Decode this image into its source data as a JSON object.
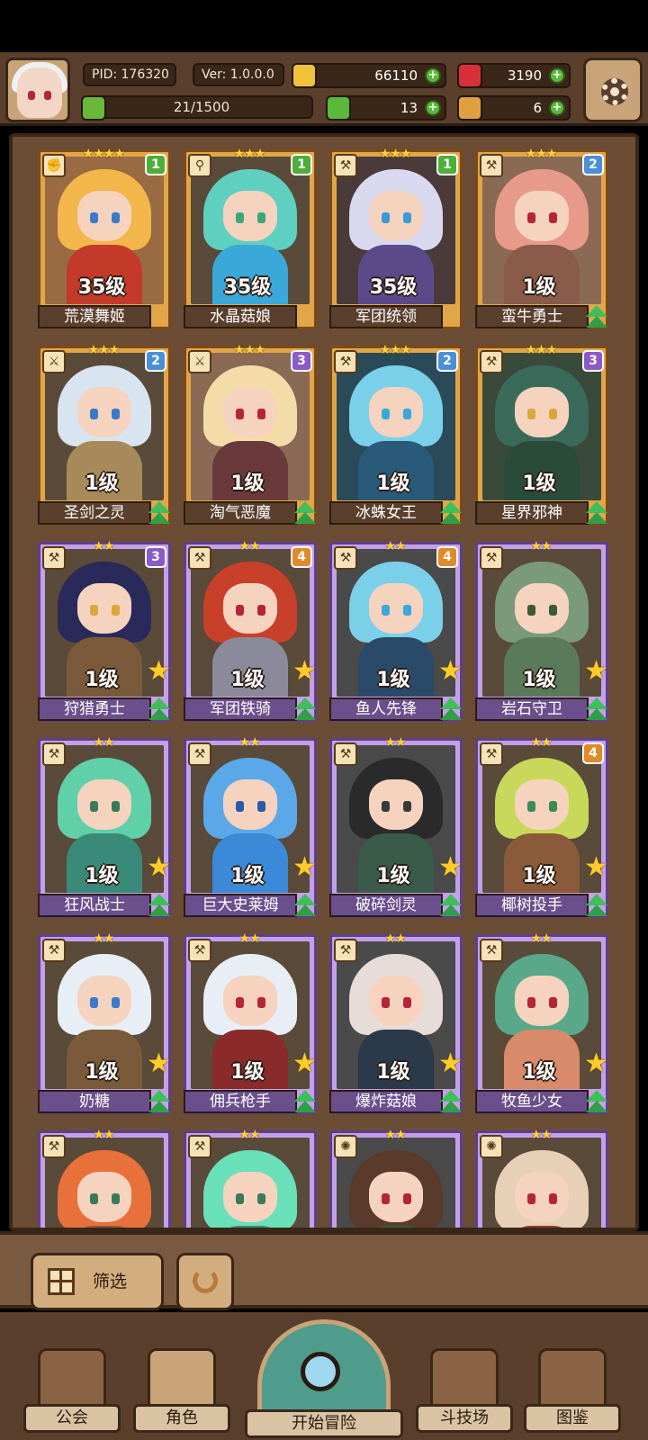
{
  "player": {
    "pid": "PID: 176320",
    "version": "Ver: 1.0.0.0",
    "exp_text": "21/1500",
    "exp_progress": 0.014
  },
  "resources": {
    "gold": "66110",
    "ruby": "3190",
    "clover": "13",
    "hammer": "6"
  },
  "colors": {
    "panel_brown": "#6b4d36",
    "card_gold": "#e0a648",
    "card_purple": "#c4a0e8",
    "upgrade_green": "#3fbf5a",
    "rank_green": "#4fae3a",
    "rank_blue": "#4a8fd8",
    "rank_purple": "#8a5ac8",
    "rank_orange": "#e08a2a"
  },
  "characters": [
    {
      "name": "荒漠舞姬",
      "level": "35级",
      "stars": "★★★★",
      "rank": "1",
      "rarity": "gold",
      "weapon_icon": "fist-icon",
      "hair": "#f2b64a",
      "body": "#c43a2a",
      "bg": "#9a6a42",
      "eye": "#3a7ac8",
      "upgrade": false
    },
    {
      "name": "水晶菇娘",
      "level": "35级",
      "stars": "★★★",
      "rank": "1",
      "rarity": "gold",
      "weapon_icon": "staff-icon",
      "hair": "#5fd0c0",
      "body": "#3aa8d8",
      "bg": "#5a4a3a",
      "eye": "#3aa87a",
      "upgrade": false
    },
    {
      "name": "军团统领",
      "level": "35级",
      "stars": "★★★",
      "rank": "1",
      "rarity": "gold",
      "weapon_icon": "axe-icon",
      "hair": "#d8d8ee",
      "body": "#5a4a8a",
      "bg": "#4a3a3a",
      "eye": "#3a9ad8",
      "upgrade": false
    },
    {
      "name": "蛮牛勇士",
      "level": "1级",
      "stars": "★★★",
      "rank": "2",
      "rarity": "gold",
      "weapon_icon": "axe-icon",
      "hair": "#e89a8a",
      "body": "#8a5a4a",
      "bg": "#8a6a54",
      "eye": "#b6243c",
      "upgrade": true
    },
    {
      "name": "圣剑之灵",
      "level": "1级",
      "stars": "★★★",
      "rank": "2",
      "rarity": "gold",
      "weapon_icon": "sword-icon",
      "hair": "#d8e4f0",
      "body": "#a88a5a",
      "bg": "#5a4a3a",
      "eye": "#3a7ac8",
      "upgrade": true
    },
    {
      "name": "淘气恶魔",
      "level": "1级",
      "stars": "★★★",
      "rank": "3",
      "rarity": "gold",
      "weapon_icon": "sword-icon",
      "hair": "#f4dca8",
      "body": "#6a3a3a",
      "bg": "#8a6a54",
      "eye": "#b6243c",
      "upgrade": true
    },
    {
      "name": "冰蛛女王",
      "level": "1级",
      "stars": "★★★",
      "rank": "2",
      "rarity": "gold",
      "weapon_icon": "axe-icon",
      "hair": "#7ad0e8",
      "body": "#2a5a7a",
      "bg": "#2a4a5a",
      "eye": "#3aa8d8",
      "upgrade": true
    },
    {
      "name": "星界邪神",
      "level": "1级",
      "stars": "★★★",
      "rank": "3",
      "rarity": "gold",
      "weapon_icon": "axe-icon",
      "hair": "#3a6a5a",
      "body": "#2a4a3a",
      "bg": "#3a4a3a",
      "eye": "#d8a83a",
      "upgrade": true
    },
    {
      "name": "狩猎勇士",
      "level": "1级",
      "stars": "★★",
      "rank": "3",
      "rarity": "purple",
      "weapon_icon": "axe-icon",
      "hair": "#2a2a5a",
      "body": "#7a5a3a",
      "bg": "#5a4a3a",
      "eye": "#d8a83a",
      "upgrade": true
    },
    {
      "name": "军团铁骑",
      "level": "1级",
      "stars": "★★",
      "rank": "4",
      "rarity": "purple",
      "weapon_icon": "axe-icon",
      "hair": "#c8402a",
      "body": "#8a8a9a",
      "bg": "#5a4a3a",
      "eye": "#b6243c",
      "upgrade": true
    },
    {
      "name": "鱼人先锋",
      "level": "1级",
      "stars": "★★",
      "rank": "4",
      "rarity": "purple",
      "weapon_icon": "axe-icon",
      "hair": "#7ad0e8",
      "body": "#2a4a6a",
      "bg": "#4a4a4a",
      "eye": "#3aa8d8",
      "upgrade": true
    },
    {
      "name": "岩石守卫",
      "level": "1级",
      "stars": "★★",
      "rank": "",
      "rarity": "purple",
      "weapon_icon": "axe-icon",
      "hair": "#7a9a7a",
      "body": "#5a7a5a",
      "bg": "#5a4a3a",
      "eye": "#3a5a3a",
      "upgrade": true
    },
    {
      "name": "狂风战士",
      "level": "1级",
      "stars": "★★",
      "rank": "",
      "rarity": "purple",
      "weapon_icon": "axe-icon",
      "hair": "#5fd0a8",
      "body": "#3a8a7a",
      "bg": "#5a4a3a",
      "eye": "#3a7a5a",
      "upgrade": true
    },
    {
      "name": "巨大史莱姆",
      "level": "1级",
      "stars": "★★",
      "rank": "",
      "rarity": "purple",
      "weapon_icon": "axe-icon",
      "hair": "#5aa8e8",
      "body": "#3a8ad8",
      "bg": "#5a4a3a",
      "eye": "#2a5aa8",
      "upgrade": true
    },
    {
      "name": "破碎剑灵",
      "level": "1级",
      "stars": "★★",
      "rank": "",
      "rarity": "purple",
      "weapon_icon": "axe-icon",
      "hair": "#2a2a2a",
      "body": "#3a5a4a",
      "bg": "#4a4a4a",
      "eye": "#3a3a3a",
      "upgrade": true
    },
    {
      "name": "椰树投手",
      "level": "1级",
      "stars": "★★",
      "rank": "4",
      "rarity": "purple",
      "weapon_icon": "axe-icon",
      "hair": "#c8d85a",
      "body": "#8a5a3a",
      "bg": "#5a4a3a",
      "eye": "#3a8a5a",
      "upgrade": true
    },
    {
      "name": "奶糖",
      "level": "1级",
      "stars": "★★",
      "rank": "",
      "rarity": "purple",
      "weapon_icon": "axe-icon",
      "hair": "#e8eef5",
      "body": "#7a5a3a",
      "bg": "#5a4a3a",
      "eye": "#3a7ac8",
      "upgrade": true
    },
    {
      "name": "佣兵枪手",
      "level": "1级",
      "stars": "★★",
      "rank": "",
      "rarity": "purple",
      "weapon_icon": "axe-icon",
      "hair": "#e8eef5",
      "body": "#8a2a2a",
      "bg": "#5a4a3a",
      "eye": "#b6243c",
      "upgrade": true
    },
    {
      "name": "爆炸菇娘",
      "level": "1级",
      "stars": "★★",
      "rank": "",
      "rarity": "purple",
      "weapon_icon": "axe-icon",
      "hair": "#e8dcd8",
      "body": "#2a3a4a",
      "bg": "#4a4a4a",
      "eye": "#b6243c",
      "upgrade": true
    },
    {
      "name": "牧鱼少女",
      "level": "1级",
      "stars": "★★",
      "rank": "",
      "rarity": "purple",
      "weapon_icon": "axe-icon",
      "hair": "#5aa88a",
      "body": "#d88a6a",
      "bg": "#5a4a3a",
      "eye": "#b6243c",
      "upgrade": true
    },
    {
      "name": "",
      "level": "",
      "stars": "★★",
      "rank": "",
      "rarity": "purple",
      "weapon_icon": "axe-icon",
      "hair": "#e8703a",
      "body": "#8a5a3a",
      "bg": "#5a4a3a",
      "eye": "#3a7a5a",
      "upgrade": false
    },
    {
      "name": "",
      "level": "",
      "stars": "★★",
      "rank": "",
      "rarity": "purple",
      "weapon_icon": "axe-icon",
      "hair": "#6ae0b8",
      "body": "#3a8a7a",
      "bg": "#5a4a3a",
      "eye": "#3a7a5a",
      "upgrade": false
    },
    {
      "name": "",
      "level": "",
      "stars": "★★",
      "rank": "",
      "rarity": "purple",
      "weapon_icon": "sun-icon",
      "hair": "#5a3a2a",
      "body": "#3a5a3a",
      "bg": "#4a4a4a",
      "eye": "#b6243c",
      "upgrade": false
    },
    {
      "name": "",
      "level": "",
      "stars": "★★",
      "rank": "",
      "rarity": "purple",
      "weapon_icon": "sun-icon",
      "hair": "#e8d0b8",
      "body": "#8a3a2a",
      "bg": "#5a4a3a",
      "eye": "#b6243c",
      "upgrade": false
    }
  ],
  "toolbar": {
    "filter_label": "筛选"
  },
  "nav": {
    "guild": "公会",
    "roles": "角色",
    "adventure": "开始冒险",
    "arena": "斗技场",
    "codex": "图鉴"
  }
}
